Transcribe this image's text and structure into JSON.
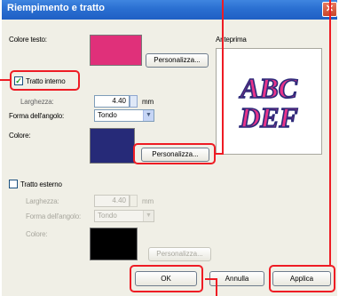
{
  "window": {
    "title": "Riempimento e tratto"
  },
  "text_color": {
    "label": "Colore testo:",
    "swatch": "#e0307a",
    "button": "Personalizza..."
  },
  "preview": {
    "label": "Anteprima",
    "line1": "ABC",
    "line2": "DEF",
    "fill": "#e8338a",
    "stroke": "#2d2a7a"
  },
  "inner_stroke": {
    "label": "Tratto interno",
    "checked": true,
    "width_label": "Larghezza:",
    "width_value": "4.40",
    "unit": "mm",
    "corner_label": "Forma dell'angolo:",
    "corner_value": "Tondo",
    "color_label": "Colore:",
    "swatch": "#262a78",
    "button": "Personalizza..."
  },
  "outer_stroke": {
    "label": "Tratto esterno",
    "checked": false,
    "width_label": "Larghezza:",
    "width_value": "4.40",
    "unit": "mm",
    "corner_label": "Forma dell'angolo:",
    "corner_value": "Tondo",
    "color_label": "Colore:",
    "swatch": "#000000",
    "button": "Personalizza..."
  },
  "footer": {
    "ok": "OK",
    "cancel": "Annulla",
    "apply": "Applica"
  },
  "colors": {
    "accent_title": "#2a6fd1",
    "callout": "#ee1c24",
    "highlight_beam": "#f7c86a"
  }
}
